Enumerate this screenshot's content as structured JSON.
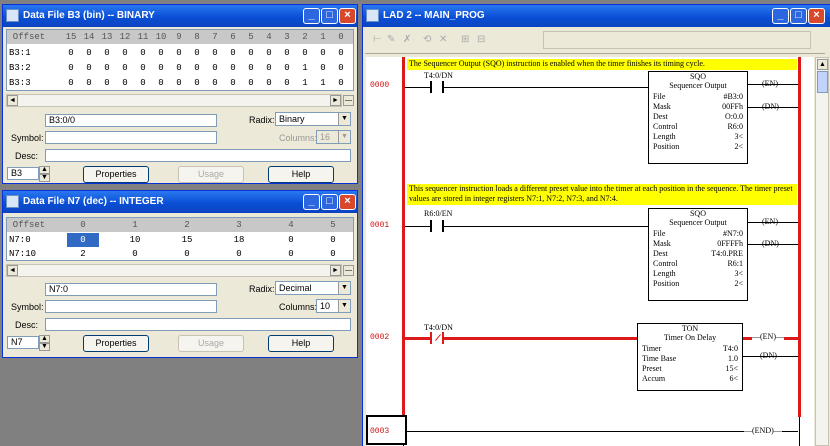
{
  "b3_window": {
    "title": "Data File B3 (bin) -- BINARY",
    "header": [
      "Offset",
      "15",
      "14",
      "13",
      "12",
      "11",
      "10",
      "9",
      "8",
      "7",
      "6",
      "5",
      "4",
      "3",
      "2",
      "1",
      "0"
    ],
    "rows": [
      {
        "addr": "B3:1",
        "bits": [
          "0",
          "0",
          "0",
          "0",
          "0",
          "0",
          "0",
          "0",
          "0",
          "0",
          "0",
          "0",
          "0",
          "0",
          "0",
          "0"
        ]
      },
      {
        "addr": "B3:2",
        "bits": [
          "0",
          "0",
          "0",
          "0",
          "0",
          "0",
          "0",
          "0",
          "0",
          "0",
          "0",
          "0",
          "0",
          "1",
          "0",
          "0"
        ]
      },
      {
        "addr": "B3:3",
        "bits": [
          "0",
          "0",
          "0",
          "0",
          "0",
          "0",
          "0",
          "0",
          "0",
          "0",
          "0",
          "0",
          "0",
          "1",
          "1",
          "0"
        ]
      }
    ],
    "address": "B3:0/0",
    "radix_label": "Radix:",
    "radix": "Binary",
    "symbol_label": "Symbol:",
    "columns_label": "Columns:",
    "columns": "16",
    "desc_label": "Desc:",
    "file": "B3",
    "properties": "Properties",
    "usage": "Usage",
    "help": "Help"
  },
  "n7_window": {
    "title": "Data File N7 (dec) -- INTEGER",
    "header": [
      "Offset",
      "0",
      "1",
      "2",
      "3",
      "4",
      "5"
    ],
    "rows": [
      {
        "addr": "N7:0",
        "vals": [
          "0",
          "10",
          "15",
          "18",
          "0",
          "0"
        ]
      },
      {
        "addr": "N7:10",
        "vals": [
          "2",
          "0",
          "0",
          "0",
          "0",
          "0"
        ]
      }
    ],
    "address": "N7:0",
    "radix_label": "Radix:",
    "radix": "Decimal",
    "symbol_label": "Symbol:",
    "columns_label": "Columns:",
    "columns": "10",
    "desc_label": "Desc:",
    "file": "N7",
    "properties": "Properties",
    "usage": "Usage",
    "help": "Help"
  },
  "lad_window": {
    "title": "LAD 2 -- MAIN_PROG",
    "rungs": [
      {
        "num": "0000",
        "comment": "The Sequencer Output (SQO) instruction is enabled when the timer finishes its timing cycle.",
        "contact": "T4:0/DN",
        "block": {
          "name": "SQO",
          "title": "Sequencer Output",
          "rows": [
            [
              "File",
              "#B3:0"
            ],
            [
              "Mask",
              "00FFh"
            ],
            [
              "Dest",
              "O:0.0"
            ],
            [
              "Control",
              "R6:0"
            ],
            [
              "Length",
              "3<"
            ],
            [
              "Position",
              "2<"
            ]
          ]
        },
        "outputs": [
          "EN",
          "DN"
        ]
      },
      {
        "num": "0001",
        "comment": "This sequencer instruction loads a different preset value into the timer at each position in the sequence. The timer preset values are stored in integer registers N7:1, N7:2, N7:3, and N7:4.",
        "contact": "R6:0/EN",
        "block": {
          "name": "SQO",
          "title": "Sequencer Output",
          "rows": [
            [
              "File",
              "#N7:0"
            ],
            [
              "Mask",
              "0FFFFh"
            ],
            [
              "Dest",
              "T4:0.PRE"
            ],
            [
              "Control",
              "R6:1"
            ],
            [
              "Length",
              "3<"
            ],
            [
              "Position",
              "2<"
            ]
          ]
        },
        "outputs": [
          "EN",
          "DN"
        ]
      },
      {
        "num": "0002",
        "comment": "",
        "contact": "T4:0/DN",
        "block": {
          "name": "TON",
          "title": "Timer On Delay",
          "rows": [
            [
              "Timer",
              "T4:0"
            ],
            [
              "Time Base",
              "1.0"
            ],
            [
              "Preset",
              "15<"
            ],
            [
              "Accum",
              "6<"
            ]
          ]
        },
        "outputs": [
          "EN",
          "DN"
        ]
      },
      {
        "num": "0003",
        "end": "END"
      }
    ]
  }
}
